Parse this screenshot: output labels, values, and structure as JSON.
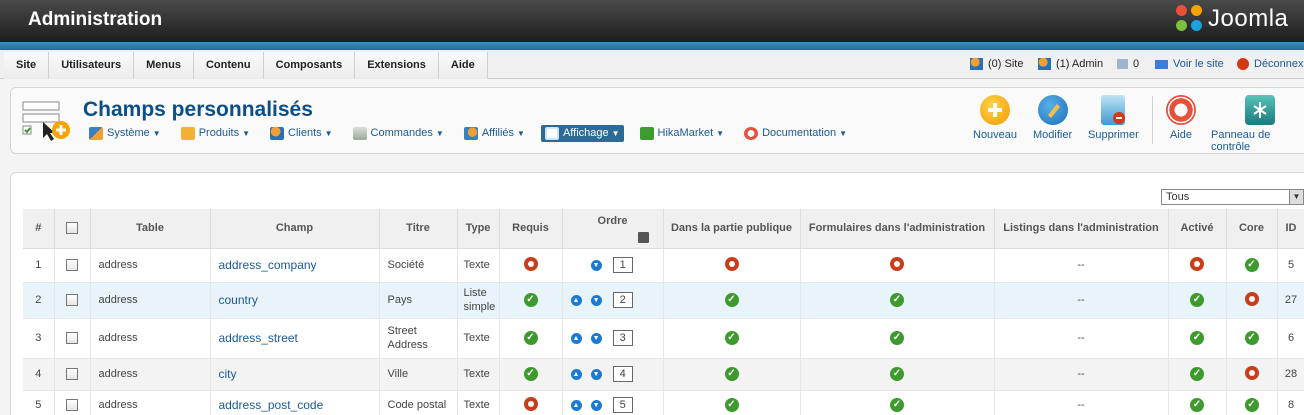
{
  "header": {
    "title": "Administration",
    "logo_text": "Joomla"
  },
  "menu": {
    "items": [
      "Site",
      "Utilisateurs",
      "Menus",
      "Contenu",
      "Composants",
      "Extensions",
      "Aide"
    ],
    "status": {
      "site": "(0) Site",
      "admin": "(1) Admin",
      "messages": "0",
      "view_site": "Voir le site",
      "logout": "Déconnexion"
    }
  },
  "toolbar": {
    "title": "Champs personnalisés",
    "submenu": [
      {
        "label": "Système",
        "icon": "tools-icon"
      },
      {
        "label": "Produits",
        "icon": "box-icon"
      },
      {
        "label": "Clients",
        "icon": "users-icon"
      },
      {
        "label": "Commandes",
        "icon": "orders-icon"
      },
      {
        "label": "Affiliés",
        "icon": "affiliate-icon"
      },
      {
        "label": "Affichage",
        "icon": "display-icon",
        "active": true
      },
      {
        "label": "HikaMarket",
        "icon": "market-icon"
      },
      {
        "label": "Documentation",
        "icon": "help-icon"
      }
    ],
    "buttons": {
      "new": "Nouveau",
      "edit": "Modifier",
      "delete": "Supprimer",
      "help": "Aide",
      "control_panel": "Panneau de contrôle"
    }
  },
  "filter": {
    "selected": "Tous"
  },
  "table": {
    "headers": {
      "num": "#",
      "table": "Table",
      "champ": "Champ",
      "titre": "Titre",
      "type": "Type",
      "requis": "Requis",
      "ordre": "Ordre",
      "public": "Dans la partie publique",
      "forms_admin": "Formulaires dans l'administration",
      "listings_admin": "Listings dans l'administration",
      "active": "Activé",
      "core": "Core",
      "id": "ID"
    },
    "rows": [
      {
        "num": "1",
        "table": "address",
        "champ": "address_company",
        "titre": "Société",
        "type": "Texte",
        "requis": false,
        "up": false,
        "down": true,
        "order": "1",
        "public": false,
        "forms": false,
        "listings": "--",
        "active": false,
        "core": true,
        "id": "5"
      },
      {
        "num": "2",
        "table": "address",
        "champ": "country",
        "titre": "Pays",
        "type": "Liste simple",
        "requis": true,
        "up": true,
        "down": true,
        "order": "2",
        "public": true,
        "forms": true,
        "listings": "--",
        "active": true,
        "core": false,
        "id": "27"
      },
      {
        "num": "3",
        "table": "address",
        "champ": "address_street",
        "titre": "Street Address",
        "type": "Texte",
        "requis": true,
        "up": true,
        "down": true,
        "order": "3",
        "public": true,
        "forms": true,
        "listings": "--",
        "active": true,
        "core": true,
        "id": "6"
      },
      {
        "num": "4",
        "table": "address",
        "champ": "city",
        "titre": "Ville",
        "type": "Texte",
        "requis": true,
        "up": true,
        "down": true,
        "order": "4",
        "public": true,
        "forms": true,
        "listings": "--",
        "active": true,
        "core": false,
        "id": "28"
      },
      {
        "num": "5",
        "table": "address",
        "champ": "address_post_code",
        "titre": "Code postal",
        "type": "Texte",
        "requis": false,
        "up": true,
        "down": true,
        "order": "5",
        "public": true,
        "forms": true,
        "listings": "--",
        "active": true,
        "core": true,
        "id": "8"
      }
    ]
  },
  "colors": {
    "brand_blue": "#0b4f8a",
    "link": "#1a5a96",
    "ok": "#3c9b2c",
    "no": "#c93d1a"
  }
}
